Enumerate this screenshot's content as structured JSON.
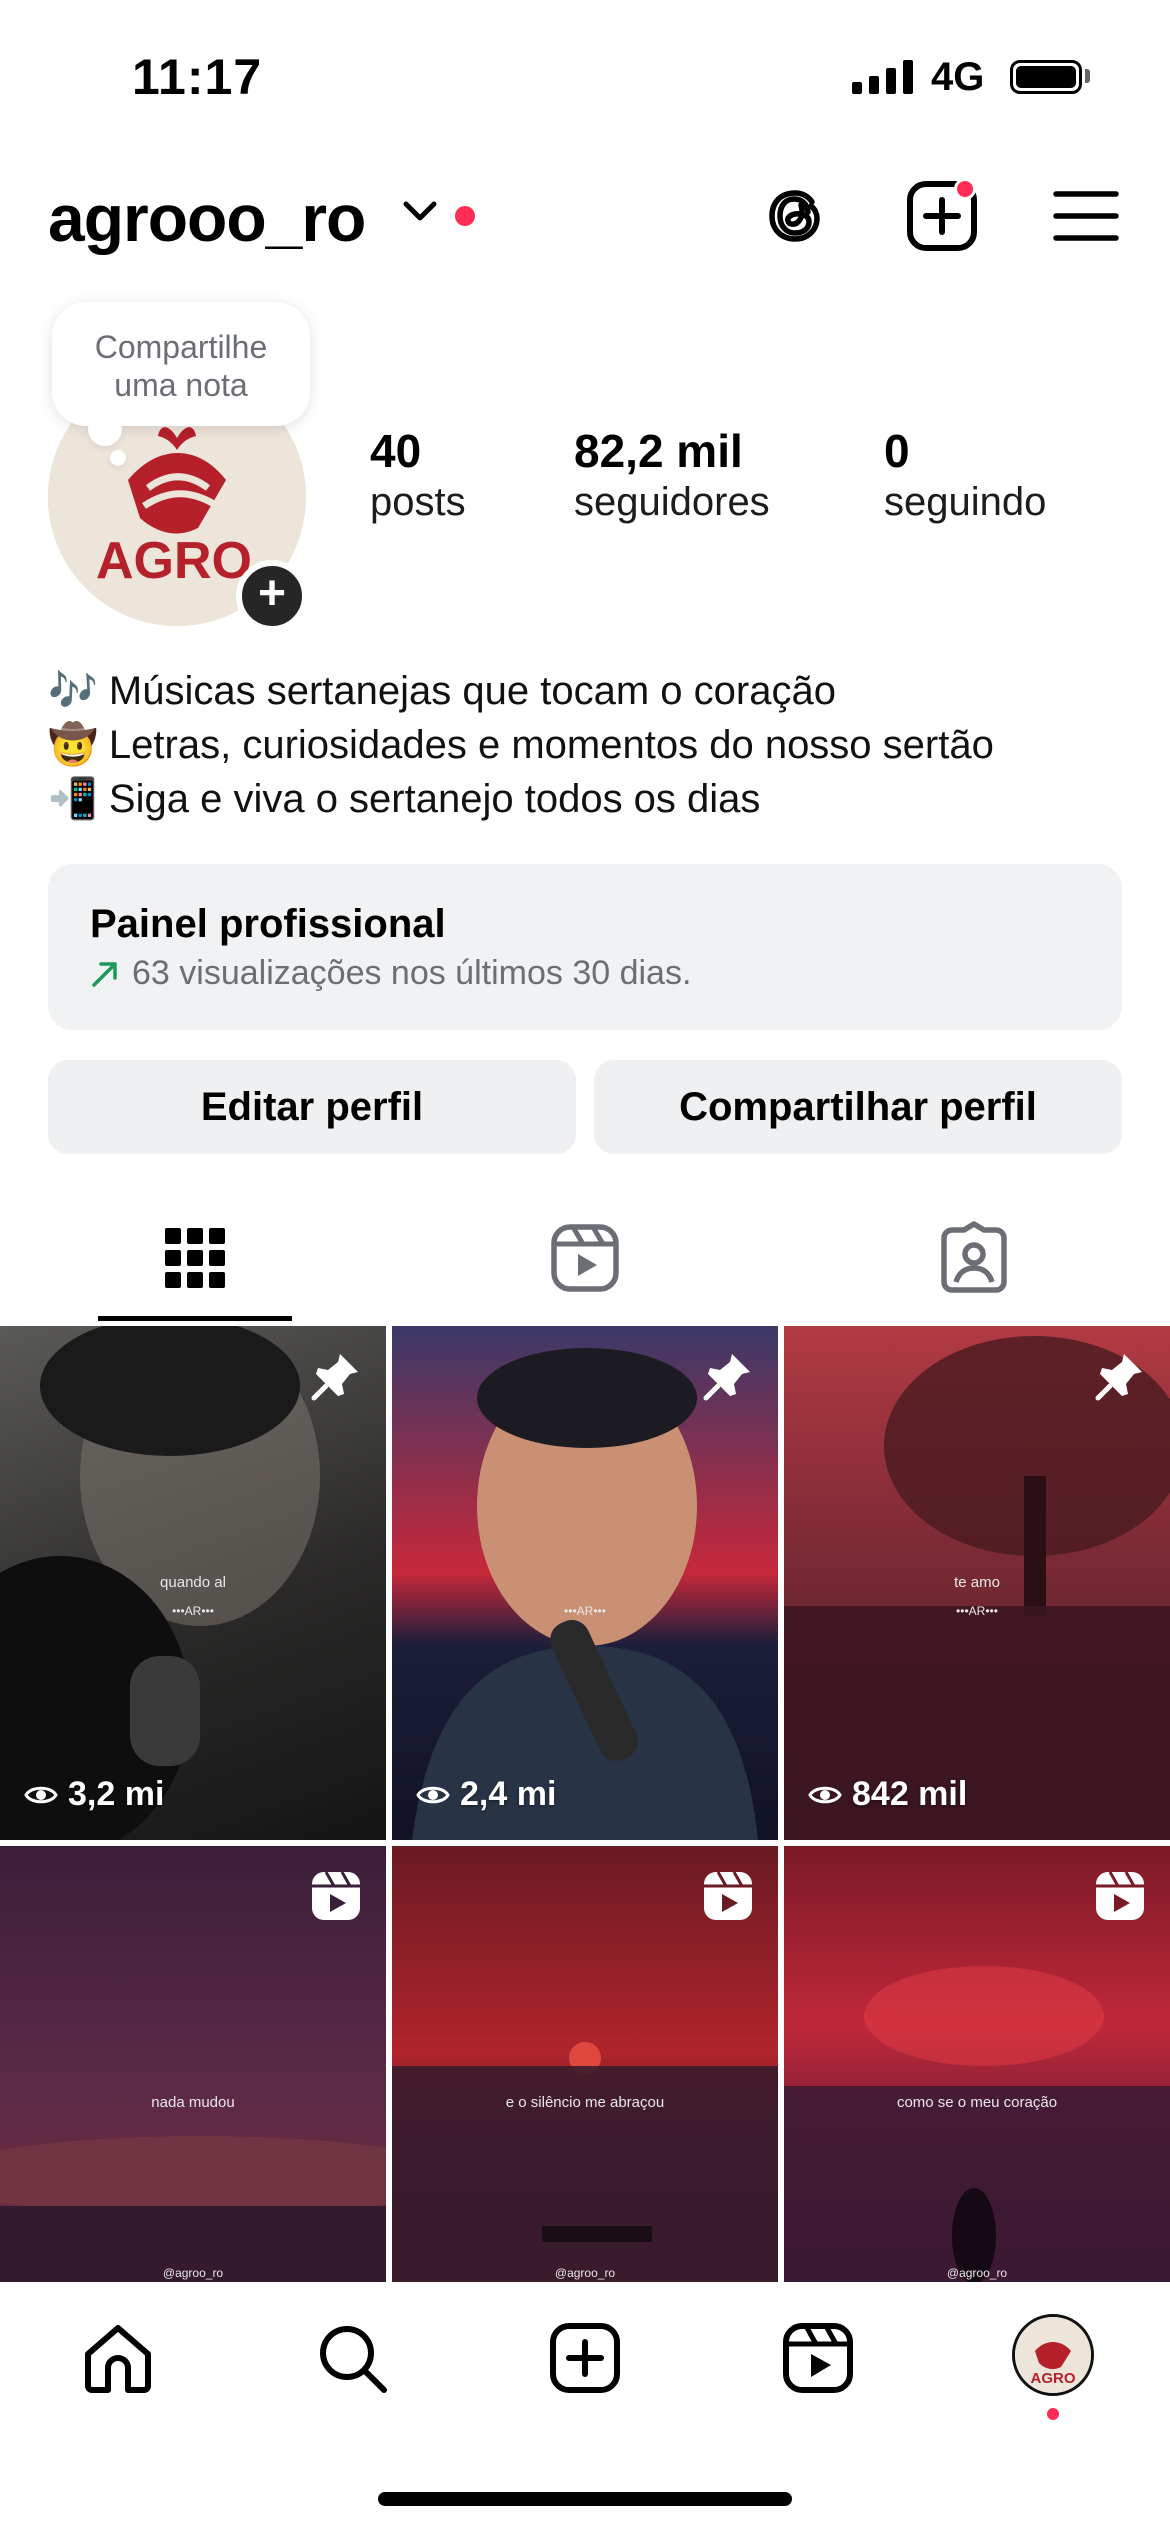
{
  "status_bar": {
    "time": "11:17",
    "network": "4G"
  },
  "header": {
    "username": "agrooo_ro",
    "icons": [
      "chevron-down-icon",
      "threads-icon",
      "create-post-icon",
      "menu-icon"
    ]
  },
  "note": {
    "line1": "Compartilhe",
    "line2": "uma nota"
  },
  "avatar": {
    "brand": "AGRO"
  },
  "stats": {
    "posts": {
      "value": "40",
      "label": "posts"
    },
    "followers": {
      "value": "82,2 mil",
      "label": "seguidores"
    },
    "following": {
      "value": "0",
      "label": "seguindo"
    }
  },
  "bio": {
    "lines": [
      "🎶 Músicas sertanejas que tocam o coração",
      "🤠 Letras, curiosidades e momentos do nosso sertão",
      "📲 Siga e viva o sertanejo todos os dias"
    ]
  },
  "dashboard": {
    "title": "Painel profissional",
    "subtitle": "63 visualizações nos últimos 30 dias."
  },
  "buttons": {
    "edit": "Editar perfil",
    "share": "Compartilhar perfil"
  },
  "tabs": [
    "grid-icon",
    "reels-icon",
    "tagged-icon"
  ],
  "posts": [
    {
      "views": "3,2 mi",
      "caption": "quando al",
      "watermark": "•••AR•••",
      "badge": "pin"
    },
    {
      "views": "2,4 mi",
      "caption": "",
      "watermark": "•••AR•••",
      "badge": "pin"
    },
    {
      "views": "842 mil",
      "caption": "te amo",
      "watermark": "•••AR•••",
      "badge": "pin"
    },
    {
      "views": "",
      "caption": "nada mudou",
      "watermark": "@agroo_ro",
      "badge": "reel"
    },
    {
      "views": "",
      "caption": "e o silêncio me abraçou",
      "watermark": "@agroo_ro",
      "badge": "reel"
    },
    {
      "views": "",
      "caption": "como se o meu coração",
      "watermark": "@agroo_ro",
      "badge": "reel"
    }
  ],
  "bottom_nav": [
    "home-icon",
    "search-icon",
    "create-icon",
    "reels-icon",
    "profile-avatar"
  ],
  "colors": {
    "notification": "#ff2d55",
    "brand_red": "#b5202a",
    "trend_green": "#1a9a57"
  }
}
